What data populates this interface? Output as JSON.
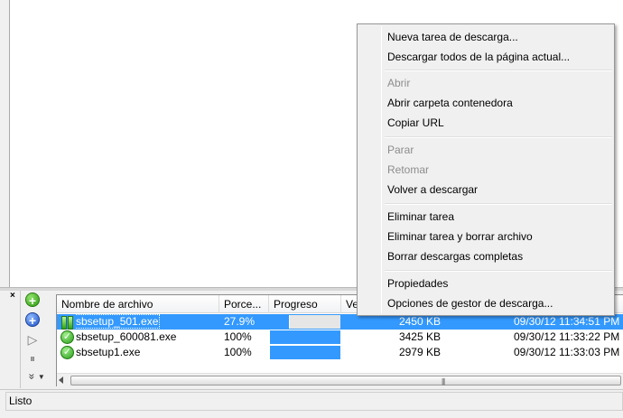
{
  "download_panel": {
    "close_glyph": "×",
    "tools": [
      {
        "icon": "add-icon",
        "glyph": "+"
      },
      {
        "icon": "add-blue-icon",
        "glyph": "+"
      },
      {
        "icon": "play-icon",
        "glyph": "▷"
      },
      {
        "icon": "pause-icon",
        "glyph": "⏸"
      },
      {
        "icon": "more-icon",
        "glyph": "»"
      }
    ],
    "columns": [
      "Nombre de archivo",
      "Porce...",
      "Progreso",
      "Ve"
    ],
    "rows": [
      {
        "name": "sbsetup_501.exe",
        "percent": "27.9%",
        "progress": 0.279,
        "size": "2450 KB",
        "date": "09/30/12 11:34:51 PM",
        "status_icon": "pause-icon",
        "selected": true
      },
      {
        "name": "sbsetup_600081.exe",
        "percent": "100%",
        "progress": 1.0,
        "size": "3425 KB",
        "date": "09/30/12 11:33:22 PM",
        "status_icon": "check-icon",
        "selected": false
      },
      {
        "name": "sbsetup1.exe",
        "percent": "100%",
        "progress": 1.0,
        "size": "2979 KB",
        "date": "09/30/12 11:33:03 PM",
        "status_icon": "check-icon",
        "selected": false
      }
    ],
    "scroll_grip": "|||"
  },
  "status": {
    "text": "Listo"
  },
  "context_menu": {
    "items": [
      {
        "label": "Nueva tarea de descarga...",
        "enabled": true
      },
      {
        "label": "Descargar todos de la página actual...",
        "enabled": true
      },
      {
        "separator": true
      },
      {
        "label": "Abrir",
        "enabled": false
      },
      {
        "label": "Abrir carpeta contenedora",
        "enabled": true
      },
      {
        "label": "Copiar URL",
        "enabled": true
      },
      {
        "separator": true
      },
      {
        "label": "Parar",
        "enabled": false
      },
      {
        "label": "Retomar",
        "enabled": false
      },
      {
        "label": "Volver a descargar",
        "enabled": true
      },
      {
        "separator": true
      },
      {
        "label": "Eliminar tarea",
        "enabled": true
      },
      {
        "label": "Eliminar tarea y borrar archivo",
        "enabled": true
      },
      {
        "label": "Borrar descargas completas",
        "enabled": true
      },
      {
        "separator": true
      },
      {
        "label": "Propiedades",
        "enabled": true
      },
      {
        "label": "Opciones de gestor de descarga...",
        "enabled": true
      }
    ]
  },
  "colors": {
    "selection": "#3399ff",
    "progress": "#3399ff",
    "disabled_text": "#8d8d8d"
  }
}
